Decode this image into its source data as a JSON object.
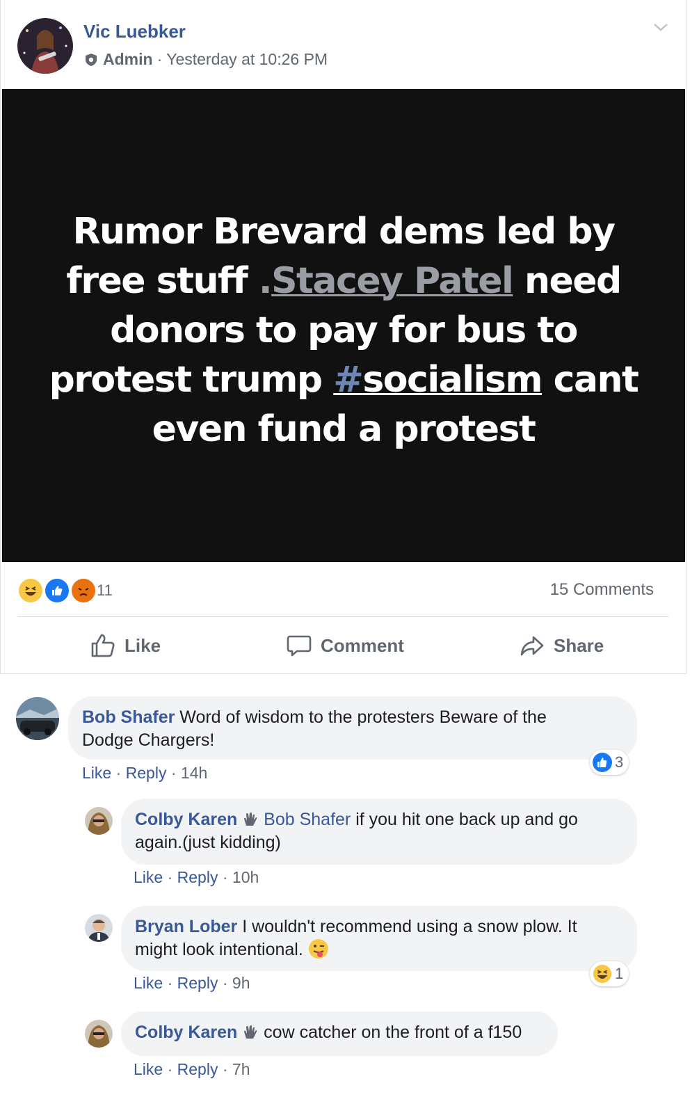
{
  "post": {
    "author": "Vic Luebker",
    "role": "Admin",
    "separator": "·",
    "timestamp": "Yesterday at 10:26 PM",
    "image_text": {
      "line1": "Rumor Brevard dems led by",
      "line2_pre": "free stuff ",
      "line2_dot": ".",
      "line2_mention": "Stacey Patel",
      "line2_post": " need",
      "line3": "donors to pay for bus to",
      "line4_pre": "protest trump ",
      "line4_hash_symbol": "#",
      "line4_hash_word": "socialism",
      "line4_post": " cant",
      "line5": "even fund a protest"
    },
    "reactions": {
      "count": "11",
      "icons": [
        "haha-icon",
        "like-icon",
        "angry-icon"
      ]
    },
    "comments_count": "15 Comments",
    "actions": {
      "like": "Like",
      "comment": "Comment",
      "share": "Share"
    }
  },
  "comments": [
    {
      "name": "Bob Shafer",
      "text_line1": " Word of wisdom to the protesters Beware of the",
      "text_line2": "Dodge Chargers!",
      "like": "Like",
      "reply": "Reply",
      "time": "14h",
      "reaction_count": "3"
    },
    {
      "name": "Colby Karen",
      "tag": "Bob Shafer",
      "text_line1": " if you hit one back up and go",
      "text_line2": "again.(just kidding)",
      "like": "Like",
      "reply": "Reply",
      "time": "10h"
    },
    {
      "name": "Bryan Lober",
      "text_line1": " I wouldn't recommend using a snow plow. It",
      "text_line2": "might look intentional.",
      "like": "Like",
      "reply": "Reply",
      "time": "9h",
      "reaction_count": "1"
    },
    {
      "name": "Colby Karen",
      "text_line1": " cow catcher on the front of a f150",
      "like": "Like",
      "reply": "Reply",
      "time": "7h"
    }
  ],
  "link_separator": "·",
  "colors": {
    "link": "#385898",
    "meta": "#606770",
    "bubble": "#f2f3f5",
    "like_blue": "#1877f2",
    "image_bg": "#111111"
  }
}
